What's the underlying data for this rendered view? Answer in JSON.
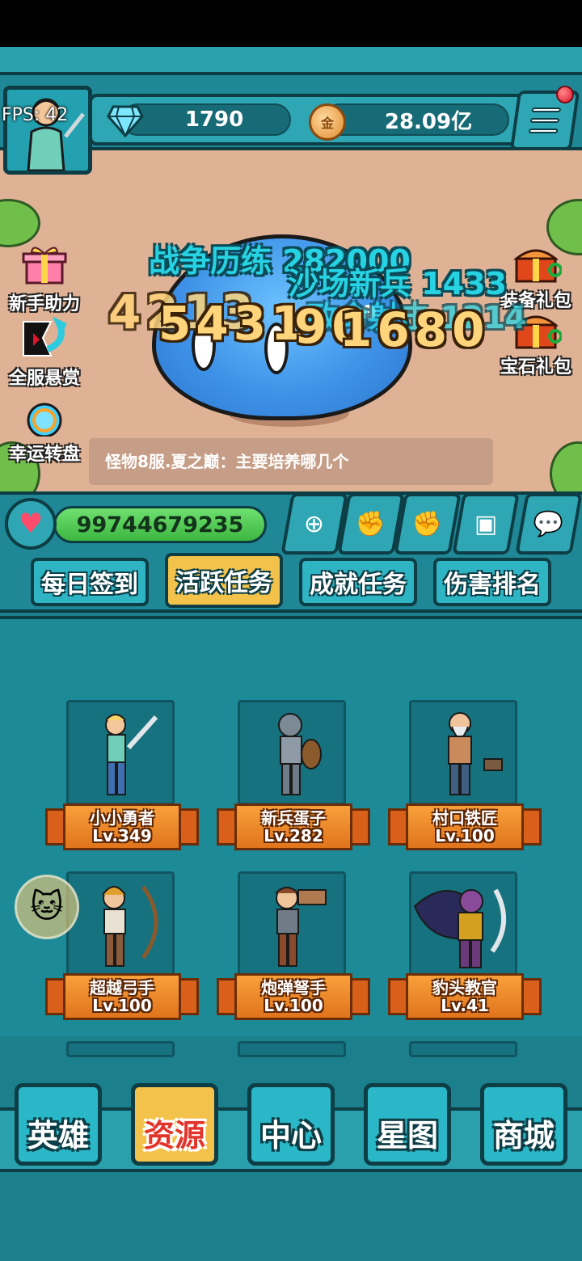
{
  "hud": {
    "fps_label": "FPS: 42",
    "gems": "1790",
    "gold": "28.09亿",
    "gold_icon_glyph": "金"
  },
  "side_left": [
    {
      "label": "新手助力",
      "icon": "gift-icon"
    },
    {
      "label": "全服悬赏",
      "icon": "bounty-flag-icon"
    },
    {
      "label": "幸运转盘",
      "icon": "wheel-icon"
    }
  ],
  "side_right": [
    {
      "label": "装备礼包",
      "icon": "chest-icon"
    },
    {
      "label": "宝石礼包",
      "icon": "gem-chest-icon"
    }
  ],
  "battle": {
    "float_1": "战争历练 282000",
    "float_2": "沙场新兵 1433",
    "float_3": "致命射击 1214",
    "damage_1": "4213",
    "damage_2": "5431",
    "damage_3": "90",
    "damage_4": "1680"
  },
  "chat": {
    "message": "怪物8服.夏之巅：主要培养哪几个"
  },
  "hp": {
    "value": "99744679235"
  },
  "tabs": [
    {
      "label": "每日签到",
      "active": false
    },
    {
      "label": "活跃任务",
      "active": true
    },
    {
      "label": "成就任务",
      "active": false
    },
    {
      "label": "伤害排名",
      "active": false
    }
  ],
  "heroes": [
    {
      "name": "小小勇者",
      "level": "Lv.349"
    },
    {
      "name": "新兵蛋子",
      "level": "Lv.282"
    },
    {
      "name": "村口铁匠",
      "level": "Lv.100"
    },
    {
      "name": "超越弓手",
      "level": "Lv.100"
    },
    {
      "name": "炮弹弩手",
      "level": "Lv.100"
    },
    {
      "name": "豹头教官",
      "level": "Lv.41"
    }
  ],
  "nav": [
    {
      "label": "英雄",
      "active": false
    },
    {
      "label": "资源",
      "active": true
    },
    {
      "label": "中心",
      "active": false
    },
    {
      "label": "星图",
      "active": false
    },
    {
      "label": "商城",
      "active": false
    }
  ],
  "colors": {
    "frame": "#2aa0ad",
    "outline": "#0d3d45",
    "arena_ground": "#e0b295",
    "active_tab": "#f3c24b",
    "hp_bar": "#3db640",
    "slime": "#3f93e8"
  }
}
